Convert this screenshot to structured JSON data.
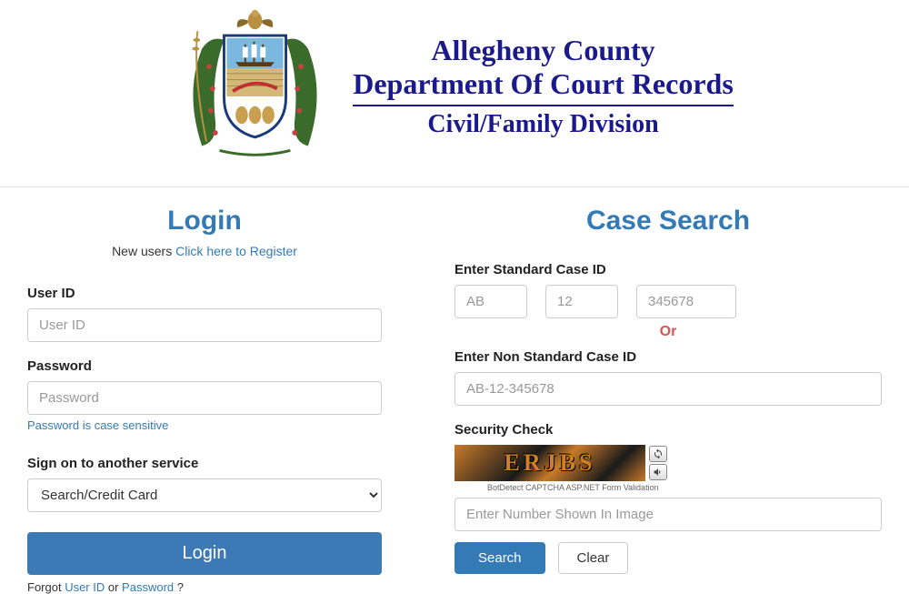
{
  "header": {
    "line1": "Allegheny County",
    "line2": "Department Of Court Records",
    "line3": "Civil/Family Division"
  },
  "login": {
    "title": "Login",
    "newusers_prefix": "New users ",
    "register_link": "Click here to Register",
    "userid_label": "User ID",
    "userid_placeholder": "User ID",
    "password_label": "Password",
    "password_placeholder": "Password",
    "password_hint": "Password is case sensitive",
    "service_label": "Sign on to another service",
    "service_selected": "Search/Credit Card",
    "login_button": "Login",
    "forgot_prefix": "Forgot ",
    "forgot_userid": "User ID",
    "forgot_or": " or ",
    "forgot_password": "Password",
    "forgot_suffix": " ?"
  },
  "search": {
    "title": "Case Search",
    "standard_label": "Enter Standard Case ID",
    "p1_placeholder": "AB",
    "p2_placeholder": "12",
    "p3_placeholder": "345678",
    "or_text": "Or",
    "nonstandard_label": "Enter Non Standard Case ID",
    "nonstandard_placeholder": "AB-12-345678",
    "security_label": "Security Check",
    "captcha_text": "ERJBS",
    "captcha_note": "BotDetect CAPTCHA ASP.NET Form Validation",
    "captcha_input_placeholder": "Enter Number Shown In Image",
    "search_button": "Search",
    "clear_button": "Clear"
  }
}
